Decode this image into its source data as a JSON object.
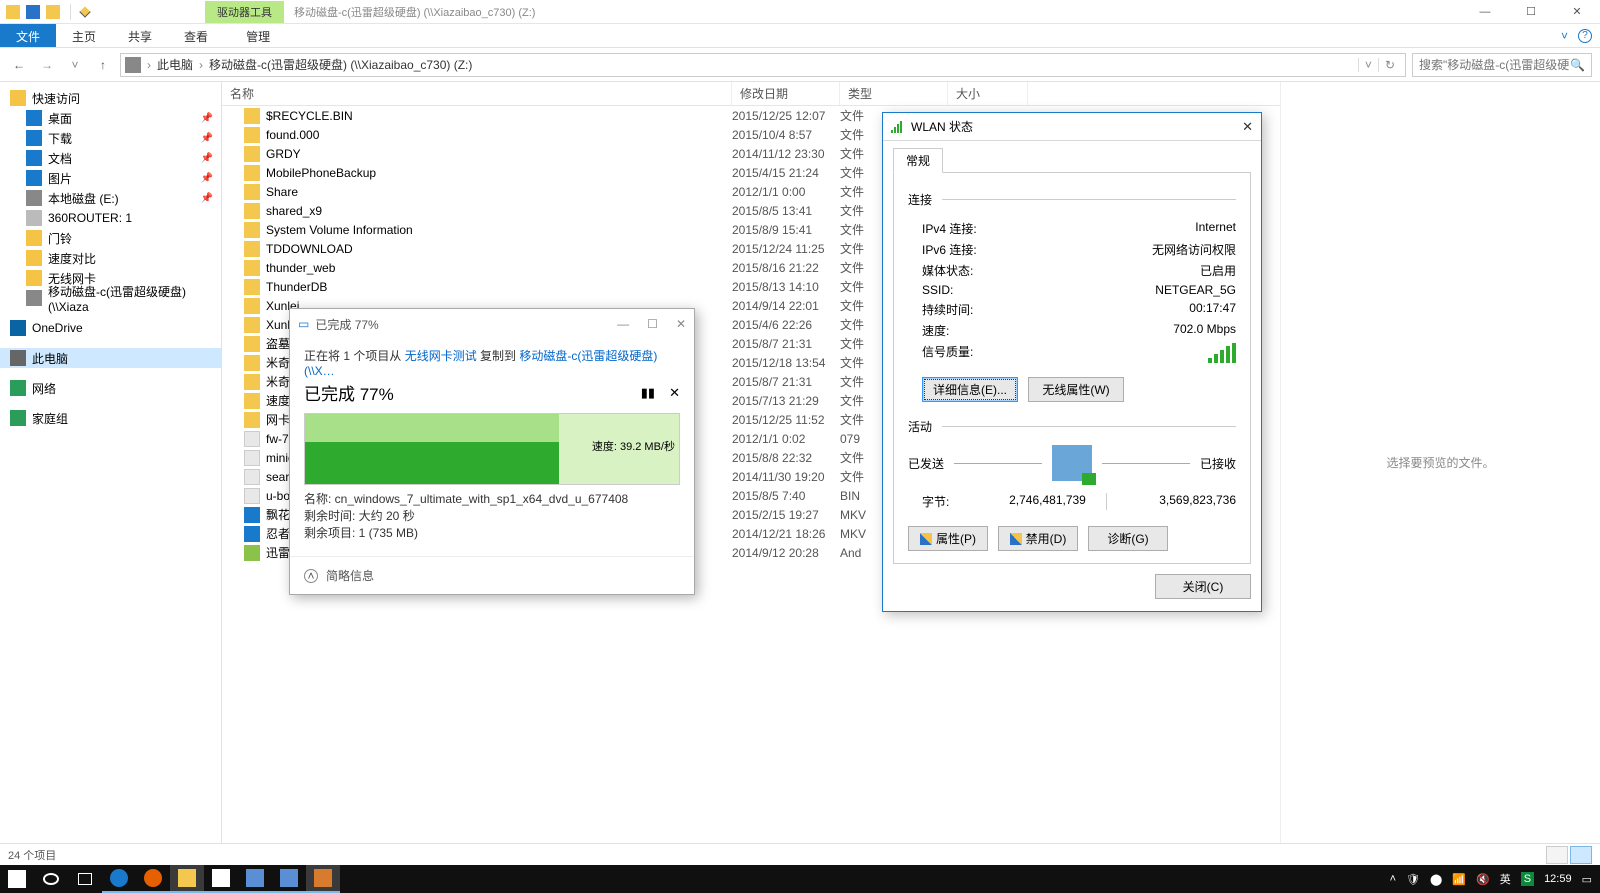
{
  "titlebar": {
    "drive_tools": "驱动器工具",
    "path": "移动磁盘-c(迅雷超级硬盘) (\\\\Xiazaibao_c730) (Z:)"
  },
  "ribbon": {
    "file": "文件",
    "home": "主页",
    "share": "共享",
    "view": "查看",
    "manage": "管理"
  },
  "address": {
    "root": "此电脑",
    "loc": "移动磁盘-c(迅雷超级硬盘) (\\\\Xiazaibao_c730) (Z:)",
    "search_placeholder": "搜索\"移动磁盘-c(迅雷超级硬…"
  },
  "nav": {
    "quick": "快速访问",
    "desktop": "桌面",
    "downloads": "下载",
    "documents": "文档",
    "pictures": "图片",
    "localE": "本地磁盘 (E:)",
    "router": "360ROUTER: 1",
    "doorbell": "门铃",
    "speed": "速度对比",
    "wlan": "无线网卡",
    "mobile": "移动磁盘-c(迅雷超级硬盘) (\\\\Xiaza",
    "onedrive": "OneDrive",
    "thispc": "此电脑",
    "network": "网络",
    "homegroup": "家庭组"
  },
  "columns": {
    "name": "名称",
    "date": "修改日期",
    "type": "类型",
    "size": "大小"
  },
  "files": [
    {
      "n": "$RECYCLE.BIN",
      "d": "2015/12/25 12:07",
      "t": "文件",
      "ic": "f"
    },
    {
      "n": "found.000",
      "d": "2015/10/4 8:57",
      "t": "文件",
      "ic": "f"
    },
    {
      "n": "GRDY",
      "d": "2014/11/12 23:30",
      "t": "文件",
      "ic": "f"
    },
    {
      "n": "MobilePhoneBackup",
      "d": "2015/4/15 21:24",
      "t": "文件",
      "ic": "f"
    },
    {
      "n": "Share",
      "d": "2012/1/1 0:00",
      "t": "文件",
      "ic": "f"
    },
    {
      "n": "shared_x9",
      "d": "2015/8/5 13:41",
      "t": "文件",
      "ic": "f"
    },
    {
      "n": "System Volume Information",
      "d": "2015/8/9 15:41",
      "t": "文件",
      "ic": "f"
    },
    {
      "n": "TDDOWNLOAD",
      "d": "2015/12/24 11:25",
      "t": "文件",
      "ic": "f"
    },
    {
      "n": "thunder_web",
      "d": "2015/8/16 21:22",
      "t": "文件",
      "ic": "f"
    },
    {
      "n": "ThunderDB",
      "d": "2015/8/13 14:10",
      "t": "文件",
      "ic": "f"
    },
    {
      "n": "Xunlei",
      "d": "2014/9/14 22:01",
      "t": "文件",
      "ic": "f"
    },
    {
      "n": "Xunlei",
      "d": "2015/4/6 22:26",
      "t": "文件",
      "ic": "f"
    },
    {
      "n": "盗墓笔",
      "d": "2015/8/7 21:31",
      "t": "文件",
      "ic": "f"
    },
    {
      "n": "米奇妙",
      "d": "2015/12/18 13:54",
      "t": "文件",
      "ic": "f"
    },
    {
      "n": "米奇妙",
      "d": "2015/8/7 21:31",
      "t": "文件",
      "ic": "f"
    },
    {
      "n": "速度与",
      "d": "2015/7/13 21:29",
      "t": "文件",
      "ic": "f"
    },
    {
      "n": "网卡测",
      "d": "2015/12/25 11:52",
      "t": "文件",
      "ic": "f"
    },
    {
      "n": "fw-76",
      "d": "2012/1/1 0:02",
      "t": "079",
      "ic": "txt"
    },
    {
      "n": "minid",
      "d": "2015/8/8 22:32",
      "t": "文件",
      "ic": "txt"
    },
    {
      "n": "search",
      "d": "2014/11/30 19:20",
      "t": "文件",
      "ic": "txt"
    },
    {
      "n": "u-boo",
      "d": "2015/8/5 7:40",
      "t": "BIN",
      "ic": "txt"
    },
    {
      "n": "飘花电",
      "d": "2015/2/15 19:27",
      "t": "MKV",
      "ic": "mkv"
    },
    {
      "n": "忍者神",
      "d": "2014/12/21 18:26",
      "t": "MKV",
      "ic": "mkv"
    },
    {
      "n": "迅雷路",
      "d": "2014/9/12 20:28",
      "t": "And",
      "ic": "apk"
    }
  ],
  "preview_text": "选择要预览的文件。",
  "statusbar": {
    "count": "24 个项目"
  },
  "copy": {
    "title_prefix": "已完成 ",
    "title_pct": "77%",
    "line_prefix": "正在将 1 个项目从 ",
    "from": "无线网卡测试",
    "mid": " 复制到 ",
    "to": "移动磁盘-c(迅雷超级硬盘) (\\\\X…",
    "done_label": "已完成 77%",
    "speed_label": "速度: ",
    "speed_val": "39.2 MB/秒",
    "name_label": "名称: ",
    "name_val": "cn_windows_7_ultimate_with_sp1_x64_dvd_u_677408",
    "remain_time_label": "剩余时间: ",
    "remain_time_val": "大约 20 秒",
    "remain_items_label": "剩余项目: ",
    "remain_items_val": "1 (735 MB)",
    "brief": "简略信息"
  },
  "wlan": {
    "title": "WLAN 状态",
    "tab": "常规",
    "sec_conn": "连接",
    "ipv4_l": "IPv4 连接:",
    "ipv4_v": "Internet",
    "ipv6_l": "IPv6 连接:",
    "ipv6_v": "无网络访问权限",
    "media_l": "媒体状态:",
    "media_v": "已启用",
    "ssid_l": "SSID:",
    "ssid_v": "NETGEAR_5G",
    "dur_l": "持续时间:",
    "dur_v": "00:17:47",
    "spd_l": "速度:",
    "spd_v": "702.0 Mbps",
    "sig_l": "信号质量:",
    "btn_details": "详细信息(E)...",
    "btn_wprops": "无线属性(W)",
    "sec_act": "活动",
    "sent": "已发送",
    "recv": "已接收",
    "bytes_l": "字节:",
    "bytes_sent": "2,746,481,739",
    "bytes_recv": "3,569,823,736",
    "btn_props": "属性(P)",
    "btn_disable": "禁用(D)",
    "btn_diag": "诊断(G)",
    "btn_close": "关闭(C)"
  },
  "taskbar": {
    "time": "12:59"
  }
}
